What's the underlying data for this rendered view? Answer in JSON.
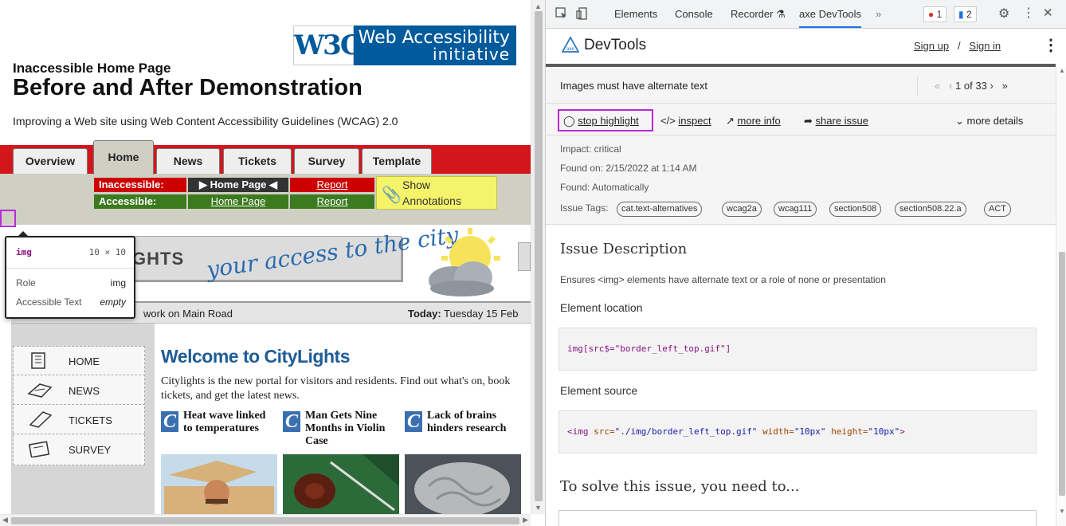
{
  "page": {
    "logo": {
      "w3c": "W3C",
      "line1": "Web Accessibility",
      "line2": "initiative"
    },
    "title_small": "Inaccessible Home Page",
    "title_large": "Before and After Demonstration",
    "subtitle": "Improving a Web site using Web Content Accessibility Guidelines (WCAG) 2.0",
    "tabs": [
      "Overview",
      "Home",
      "News",
      "Tickets",
      "Survey",
      "Template"
    ],
    "inaccessible": {
      "label": "Inaccessible:",
      "page": "▶ Home Page ◀",
      "report": "Report"
    },
    "accessible": {
      "label": "Accessible:",
      "page": "Home Page",
      "report": "Report"
    },
    "annotations": {
      "line1": "Show",
      "line2": "Annotations"
    },
    "banner": {
      "brand": "GHTS",
      "tagline": "your access to the city"
    },
    "ticker": {
      "left": "work on Main Road",
      "today_label": "Today:",
      "today_value": "Tuesday 15 Feb"
    },
    "nav": [
      "HOME",
      "NEWS",
      "TICKETS",
      "SURVEY"
    ],
    "welcome": "Welcome to CityLights",
    "intro": "Citylights is the new portal for visitors and residents. Find out what's on, book tickets, and get the latest news.",
    "news": [
      {
        "c": "C",
        "headline": "Heat wave linked to temperatures"
      },
      {
        "c": "C",
        "headline": "Man Gets Nine Months in Violin Case"
      },
      {
        "c": "C",
        "headline": "Lack of brains hinders research"
      }
    ],
    "tooltip": {
      "tag": "img",
      "size": "10 × 10",
      "role_label": "Role",
      "role_value": "img",
      "text_label": "Accessible Text",
      "text_value": "empty"
    }
  },
  "devtools": {
    "tabs": [
      "Elements",
      "Console",
      "Recorder ⚗",
      "axe DevTools",
      "»"
    ],
    "errors": "1",
    "messages": "2",
    "brand": "DevTools",
    "sign_up": "Sign up",
    "sep": "/",
    "sign_in": "Sign in",
    "issue_title": "Images must have alternate text",
    "pager": {
      "first": "«",
      "prev": "‹",
      "text": "1 of 33",
      "next": "›",
      "last": "»"
    },
    "actions": {
      "stop": "stop highlight",
      "inspect": "inspect",
      "more_info": "more info",
      "share": "share issue",
      "more_details": "more details"
    },
    "impact": "Impact: critical",
    "found_on": "Found on: 2/15/2022 at 1:14 AM",
    "found": "Found: Automatically",
    "tags_label": "Issue Tags:",
    "tags": [
      "cat.text-alternatives",
      "wcag2a",
      "wcag111",
      "section508",
      "section508.22.a",
      "ACT"
    ],
    "desc_heading": "Issue Description",
    "desc_text": "Ensures <img> elements have alternate text or a role of none or presentation",
    "loc_heading": "Element location",
    "loc_code": "img[src$=\"border_left_top.gif\"]",
    "src_heading": "Element source",
    "src_code": {
      "open": "<img",
      "a1": "src=",
      "v1": "\"./img/border_left_top.gif\"",
      "a2": "width=",
      "v2": "\"10px\"",
      "a3": "height=",
      "v3": "\"10px\"",
      "close": ">"
    },
    "solve_heading": "To solve this issue, you need to..."
  }
}
